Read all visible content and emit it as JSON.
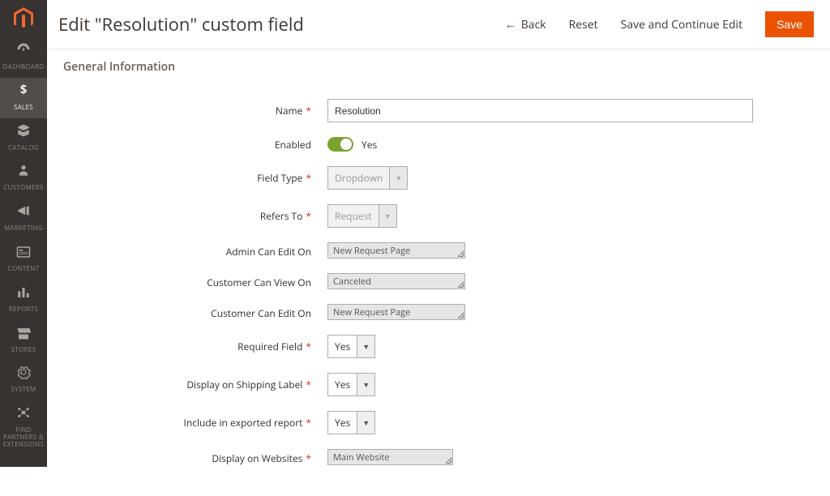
{
  "sidebar": {
    "items": [
      {
        "label": "DASHBOARD",
        "icon": "dashboard"
      },
      {
        "label": "SALES",
        "icon": "sales"
      },
      {
        "label": "CATALOG",
        "icon": "catalog"
      },
      {
        "label": "CUSTOMERS",
        "icon": "customers"
      },
      {
        "label": "MARKETING",
        "icon": "marketing"
      },
      {
        "label": "CONTENT",
        "icon": "content"
      },
      {
        "label": "REPORTS",
        "icon": "reports"
      },
      {
        "label": "STORES",
        "icon": "stores"
      },
      {
        "label": "SYSTEM",
        "icon": "system"
      },
      {
        "label": "FIND PARTNERS & EXTENSIONS",
        "icon": "partners"
      }
    ]
  },
  "header": {
    "title": "Edit \"Resolution\" custom field",
    "back": "Back",
    "reset": "Reset",
    "save_continue": "Save and Continue Edit",
    "save": "Save"
  },
  "section": {
    "title": "General Information"
  },
  "form": {
    "name_label": "Name",
    "name_value": "Resolution",
    "enabled_label": "Enabled",
    "enabled_value": "Yes",
    "field_type_label": "Field Type",
    "field_type_value": "Dropdown",
    "refers_to_label": "Refers To",
    "refers_to_value": "Request",
    "admin_edit_label": "Admin Can Edit On",
    "admin_edit_value": "New Request Page",
    "customer_view_label": "Customer Can View On",
    "customer_view_value": "Canceled",
    "customer_edit_label": "Customer Can Edit On",
    "customer_edit_value": "New Request Page",
    "required_label": "Required Field",
    "required_value": "Yes",
    "shipping_label": "Display on Shipping Label",
    "shipping_value": "Yes",
    "export_label": "Include in exported report",
    "export_value": "Yes",
    "websites_label": "Display on Websites",
    "websites_value": "Main Website"
  }
}
